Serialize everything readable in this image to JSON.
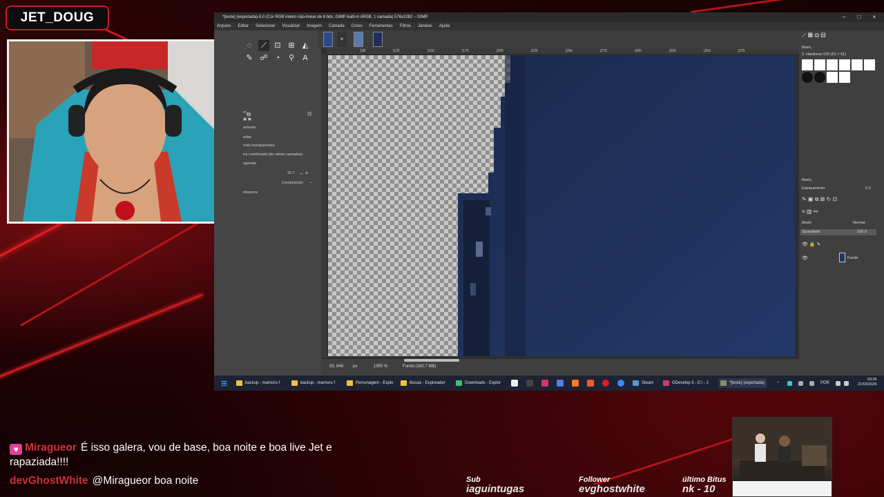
{
  "overlay": {
    "streamer_name": "JET_DOUG",
    "accent_color": "#c81b22",
    "stats": [
      {
        "label": "Sub",
        "value": "iaguintugas"
      },
      {
        "label": "Follower",
        "value": "evghostwhite"
      },
      {
        "label": "último Bitus",
        "value": "nk - 10"
      }
    ]
  },
  "chat": [
    {
      "user": "Miragueor",
      "badge": "heart-icon",
      "text": "É isso galera, vou de base, boa noite e boa live Jet e rapaziada!!!!"
    },
    {
      "user": "devGhostWhite",
      "text": "@Miragueor boa noite"
    }
  ],
  "gimp": {
    "title": "*[teste] (exportada)-5.0 (Cor RGB inteiro não-linear de 8 bits, GIMP built-in sRGB, 1 camada) 576x1082 – GIMP",
    "menu": [
      "Arquivo",
      "Editar",
      "Selecionar",
      "Visualizar",
      "Imagem",
      "Camada",
      "Cores",
      "Ferramentas",
      "Filtros",
      "Janelas",
      "Ajuda"
    ],
    "tool_options": {
      "line1": "m",
      "line2": "amento",
      "line3": "edas",
      "line4": "reas transparentes",
      "line5": "tra combinada (de várias camadas)",
      "line6": "agonais",
      "value": "32.7",
      "mode": "Composição",
      "line7": "ntoscora"
    },
    "ruler_ticks": [
      "100",
      "|125",
      "|150",
      "|175",
      "|200",
      "|225",
      "|250",
      "|275",
      "|300",
      "|325",
      "|350",
      "|375"
    ],
    "status": {
      "coords": "93, 848",
      "unit": "px",
      "zoom": "1950 %",
      "info": "Fundo (160,7 MB)"
    },
    "dock": {
      "brush_preset": "Basic,",
      "brush_name": "2. Hardness 025 (51 × 51)",
      "brush_preset2": "Basic,",
      "spacing_label": "Espaçamento",
      "spacing_value": "5.0",
      "mode_label": "Modo",
      "mode_value": "Normal",
      "opacity_label": "Opacidade",
      "opacity_value": "100.0",
      "layer_name": "Fundo"
    }
  },
  "taskbar": {
    "items": [
      "backup - mamoru f",
      "backup - mamoru f",
      "Personagem - Explo",
      "blusas - Explorador",
      "Downloads - Explor",
      "Steam",
      "GDevelop 5 - E:\\ - J",
      "*[teste] (exportada)"
    ],
    "language": "POR",
    "time": "03:35",
    "date": "21/02/2026"
  }
}
